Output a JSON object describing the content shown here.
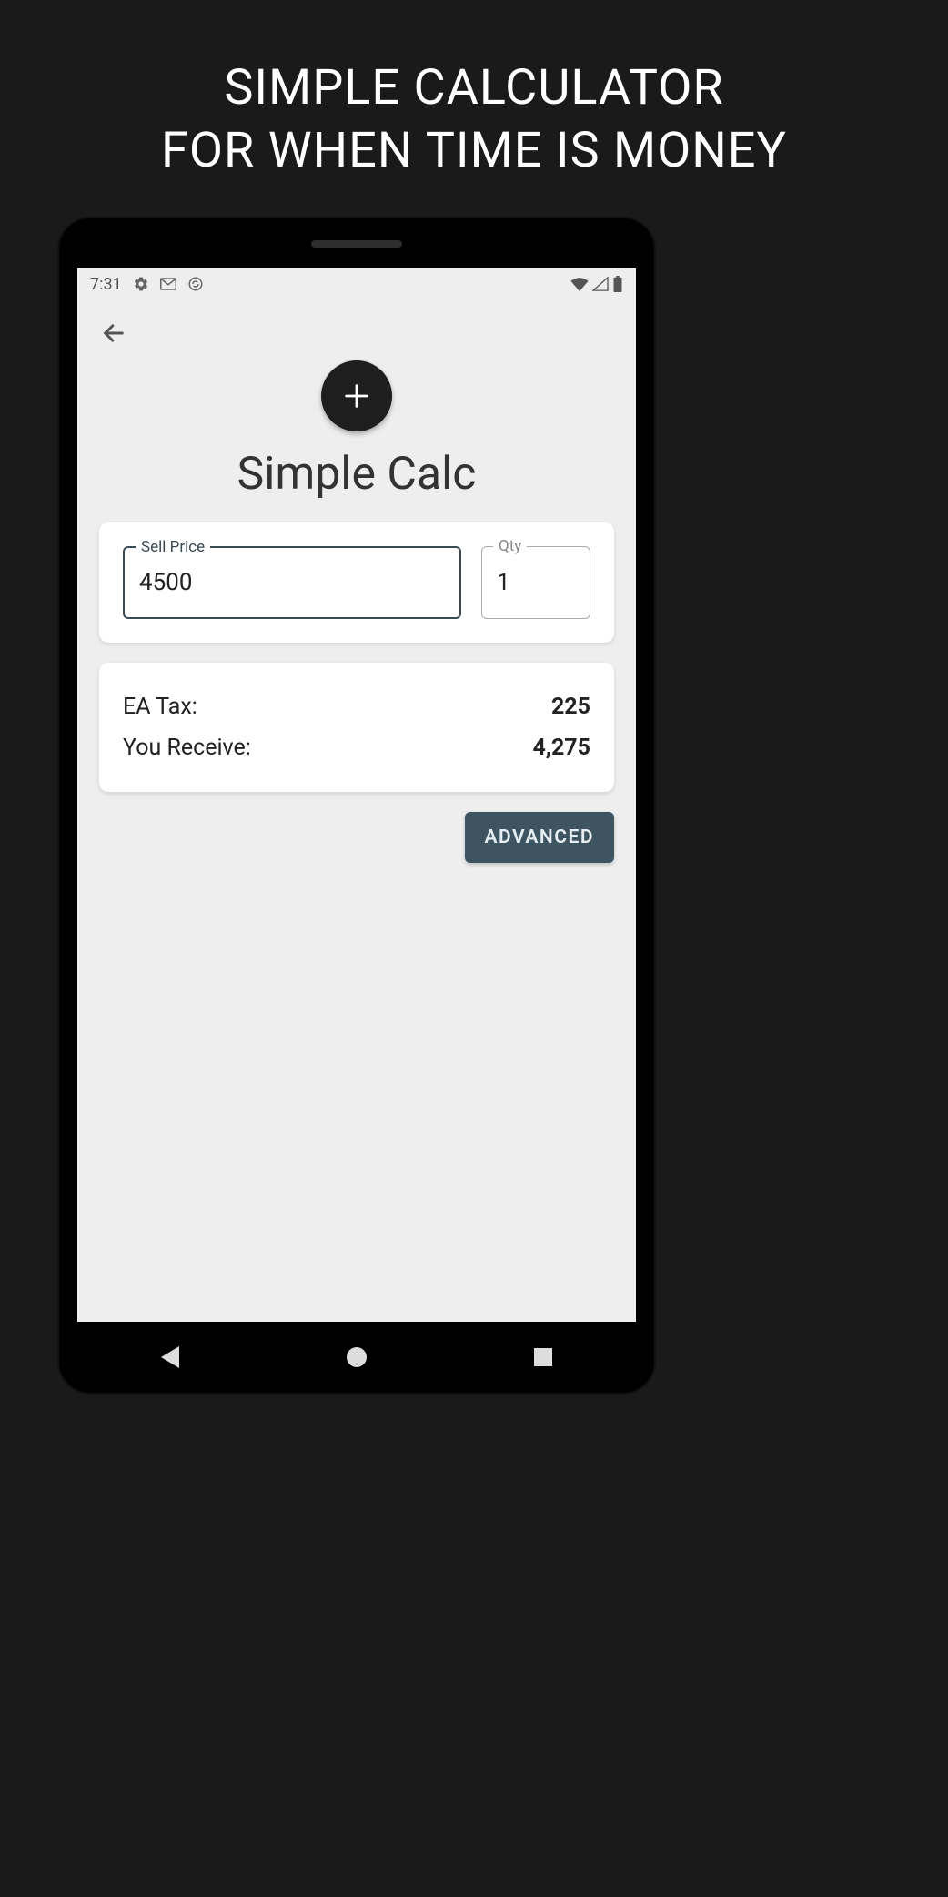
{
  "headline": {
    "line1": "SIMPLE CALCULATOR",
    "line2": "FOR WHEN TIME IS MONEY"
  },
  "status_bar": {
    "time": "7:31",
    "icons_left": [
      "gear-icon",
      "mail-icon",
      "sync-icon"
    ],
    "icons_right": [
      "wifi-icon",
      "signal-icon",
      "battery-icon"
    ]
  },
  "app": {
    "title": "Simple Calc",
    "fab_icon": "plus-icon",
    "back_icon": "back-arrow-icon"
  },
  "fields": {
    "sell_price": {
      "label": "Sell Price",
      "value": "4500"
    },
    "qty": {
      "label": "Qty",
      "value": "1"
    }
  },
  "results": {
    "ea_tax": {
      "label": "EA Tax:",
      "value": "225"
    },
    "you_receive": {
      "label": "You Receive:",
      "value": "4,275"
    }
  },
  "buttons": {
    "advanced": "ADVANCED"
  },
  "nav": {
    "back": "nav-back-icon",
    "home": "nav-home-icon",
    "recents": "nav-recents-icon"
  }
}
